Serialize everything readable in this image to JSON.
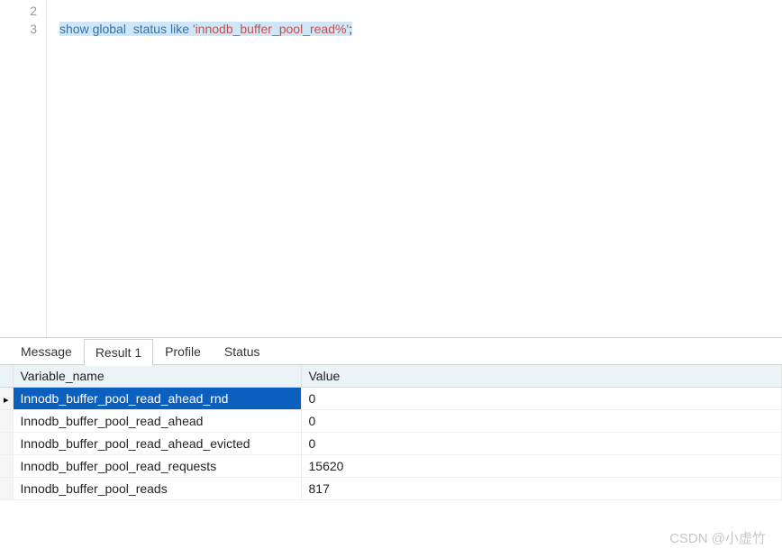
{
  "editor": {
    "lines": [
      {
        "number": "2",
        "content": ""
      },
      {
        "number": "3",
        "content_selected": true,
        "tokens": [
          {
            "t": "show",
            "cls": "sql-keyword"
          },
          {
            "t": " ",
            "cls": ""
          },
          {
            "t": "global",
            "cls": "sql-keyword"
          },
          {
            "t": "  ",
            "cls": ""
          },
          {
            "t": "status",
            "cls": "sql-keyword"
          },
          {
            "t": " ",
            "cls": ""
          },
          {
            "t": "like",
            "cls": "sql-keyword"
          },
          {
            "t": " ",
            "cls": ""
          },
          {
            "t": "'innodb_buffer_pool_read%'",
            "cls": "sql-string"
          },
          {
            "t": ";",
            "cls": "sql-punct"
          }
        ]
      }
    ]
  },
  "tabs": {
    "items": [
      {
        "label": "Message",
        "active": false
      },
      {
        "label": "Result 1",
        "active": true
      },
      {
        "label": "Profile",
        "active": false
      },
      {
        "label": "Status",
        "active": false
      }
    ]
  },
  "results": {
    "headers": {
      "col1": "Variable_name",
      "col2": "Value"
    },
    "rows": [
      {
        "variable": "Innodb_buffer_pool_read_ahead_rnd",
        "value": "0",
        "selected": true,
        "cursor": true
      },
      {
        "variable": "Innodb_buffer_pool_read_ahead",
        "value": "0",
        "selected": false,
        "cursor": false
      },
      {
        "variable": "Innodb_buffer_pool_read_ahead_evicted",
        "value": "0",
        "selected": false,
        "cursor": false
      },
      {
        "variable": "Innodb_buffer_pool_read_requests",
        "value": "15620",
        "selected": false,
        "cursor": false
      },
      {
        "variable": "Innodb_buffer_pool_reads",
        "value": "817",
        "selected": false,
        "cursor": false
      }
    ]
  },
  "watermark": "CSDN @小虚竹"
}
